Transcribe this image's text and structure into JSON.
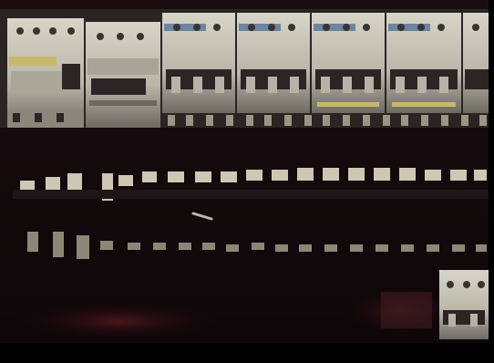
{
  "image": {
    "subject": "electrical-panel-circuit-breakers",
    "palette": {
      "background": "#140a0c",
      "breaker_body": "#c8c6b8",
      "breaker_shadow": "#6b6a60",
      "toggle": "#2b2525",
      "label_strip": "#c9b86a",
      "terminal": "#c7bfae",
      "terminal_dim": "#8d8678",
      "bottom_band": "#000000",
      "red_glow": "#4a1418"
    }
  }
}
